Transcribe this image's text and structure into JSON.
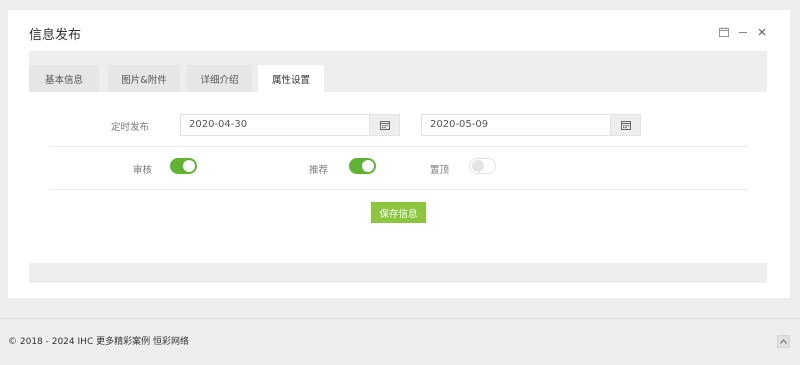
{
  "panel": {
    "title": "信息发布"
  },
  "tabs": [
    {
      "label": "基本信息",
      "active": false
    },
    {
      "label": "图片&附件",
      "active": false
    },
    {
      "label": "详细介绍",
      "active": false
    },
    {
      "label": "属性设置",
      "active": true
    }
  ],
  "schedule": {
    "label": "定时发布",
    "start_date": "2020-04-30",
    "end_date": "2020-05-09"
  },
  "toggles": [
    {
      "label": "审核",
      "on": true
    },
    {
      "label": "推荐",
      "on": true
    },
    {
      "label": "置顶",
      "on": false
    }
  ],
  "actions": {
    "save_label": "保存信息"
  },
  "footer": {
    "copyright": "© 2018 - 2024",
    "brand": "IHC",
    "link_cases": "更多精彩案例",
    "link_company": "恒彩网络"
  },
  "colors": {
    "accent_green": "#5fb333",
    "button_green": "#8cc63f"
  },
  "icons": [
    "calendar-icon",
    "minimize-icon",
    "close-icon",
    "chevron-up-icon"
  ]
}
